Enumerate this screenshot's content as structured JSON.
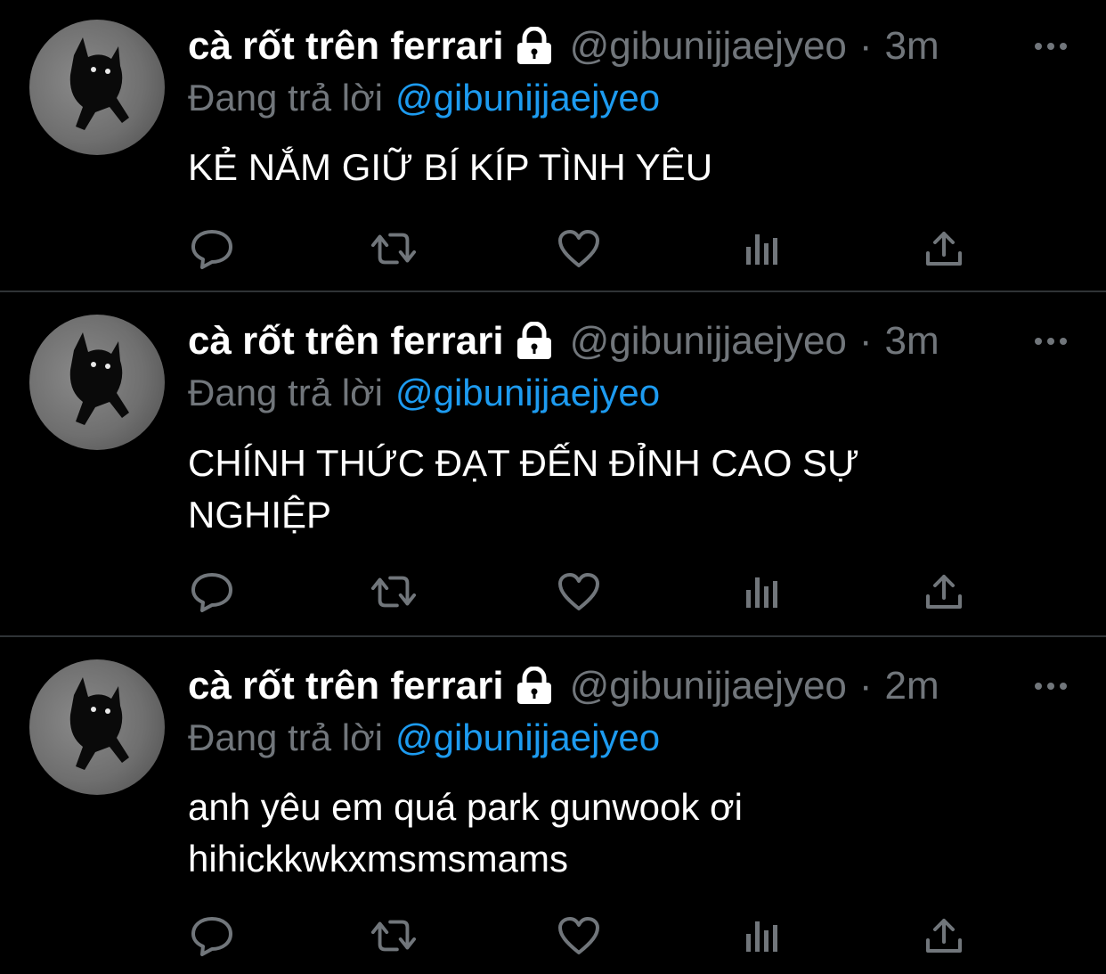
{
  "tweets": [
    {
      "display_name": "cà rốt trên ferrari",
      "handle": "@gibunijjaejyeo",
      "separator": "·",
      "time": "3m",
      "replying_prefix": "Đang trả lời",
      "replying_to": "@gibunijjaejyeo",
      "text": "KẺ NẮM GIỮ BÍ KÍP TÌNH YÊU"
    },
    {
      "display_name": "cà rốt trên ferrari",
      "handle": "@gibunijjaejyeo",
      "separator": "·",
      "time": "3m",
      "replying_prefix": "Đang trả lời",
      "replying_to": "@gibunijjaejyeo",
      "text": "CHÍNH THỨC ĐẠT ĐẾN ĐỈNH CAO SỰ NGHIỆP"
    },
    {
      "display_name": "cà rốt trên ferrari",
      "handle": "@gibunijjaejyeo",
      "separator": "·",
      "time": "2m",
      "replying_prefix": "Đang trả lời",
      "replying_to": "@gibunijjaejyeo",
      "text": "anh yêu em quá park gunwook ơi hihickkwkxmsmsmams"
    }
  ],
  "icons": {
    "avatar": "black-cat-avatar",
    "lock": "lock-icon",
    "more": "more-dots-icon",
    "reply": "reply-icon",
    "retweet": "retweet-icon",
    "like": "heart-icon",
    "views": "analytics-icon",
    "share": "share-icon"
  },
  "colors": {
    "background": "#000000",
    "text": "#ffffff",
    "secondary": "#71767b",
    "mention": "#1d9bf0",
    "divider": "#2f3336"
  }
}
